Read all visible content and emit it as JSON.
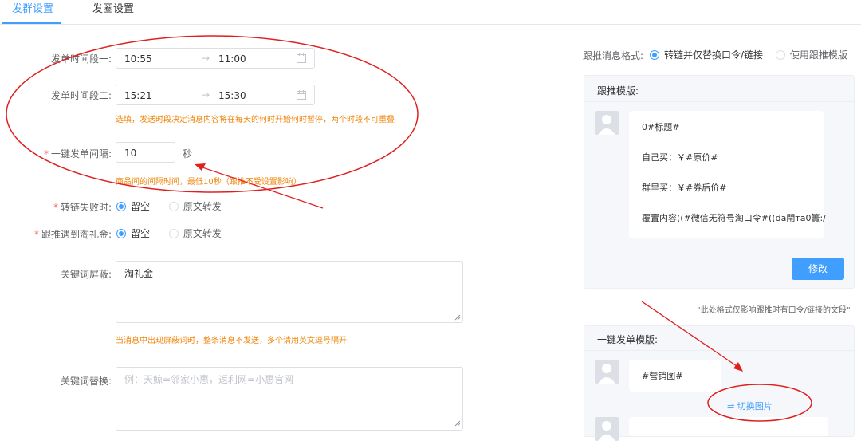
{
  "tabs": [
    {
      "label": "发群设置",
      "active": true
    },
    {
      "label": "发圈设置",
      "active": false
    }
  ],
  "form": {
    "period1": {
      "label": "发单时间段一:",
      "start": "10:55",
      "end": "11:00",
      "sep": "→"
    },
    "period2": {
      "label": "发单时间段二:",
      "start": "15:21",
      "end": "15:30",
      "sep": "→"
    },
    "period_hint": "选填，发送时段决定消息内容将在每天的何时开始何时暂停，两个时段不可重叠",
    "interval": {
      "label": "一键发单间隔:",
      "value": "10",
      "unit": "秒",
      "hint": "商品间的间隔时间，最低10秒（跟推不受设置影响）"
    },
    "link_fail": {
      "label": "转链失败时:",
      "options": [
        "留空",
        "原文转发"
      ],
      "selected": 0
    },
    "tlj": {
      "label": "跟推遇到淘礼金:",
      "options": [
        "留空",
        "原文转发"
      ],
      "selected": 0
    },
    "keyword_block": {
      "label": "关键词屏蔽:",
      "value": "淘礼金",
      "hint": "当消息中出现屏蔽词时，整条消息不发送，多个请用英文逗号隔开"
    },
    "keyword_replace": {
      "label": "关键词替换:",
      "placeholder": "例：天鲸=邻家小惠，返利网=小惠官网"
    }
  },
  "right": {
    "format": {
      "label": "跟推消息格式:",
      "options": [
        "转链并仅替换口令/链接",
        "使用跟推模版"
      ],
      "selected": 0
    },
    "follow_template": {
      "title": "跟推模版:",
      "lines": [
        "0#标题#",
        "自己买：￥#原价#",
        "群里买：￥#券后价#",
        "覆置内容((#微信无符号淘口令#((da閈тa0簀:/"
      ],
      "edit_label": "修改"
    },
    "note": "\"此处格式仅影响跟推时有口令/链接的文段\"",
    "one_key_template": {
      "title": "一键发单模版:",
      "line": "#营销图#",
      "switch_label": "切换图片"
    }
  },
  "colors": {
    "primary": "#409eff",
    "hint": "#f0850a",
    "annotation": "#e02020"
  }
}
